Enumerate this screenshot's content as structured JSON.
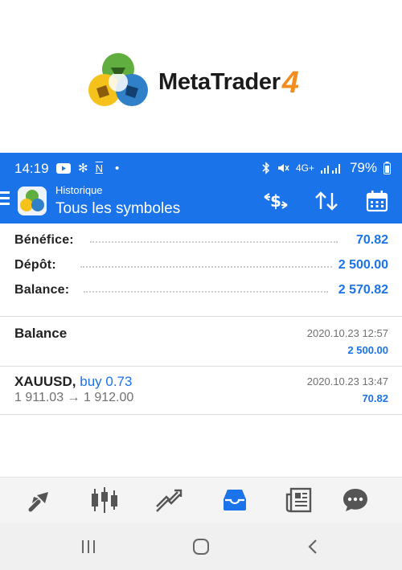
{
  "brand": {
    "name": "MetaTrader",
    "version": "4"
  },
  "status_bar": {
    "time": "14:19",
    "network_label": "4G+",
    "battery": "79%",
    "n_icon_text": "N",
    "dot": "•"
  },
  "toolbar": {
    "subtitle": "Historique",
    "title": "Tous les symboles"
  },
  "summary": [
    {
      "label": "Bénéfice:",
      "value": "70.82"
    },
    {
      "label": "Dépôt:",
      "value": "2 500.00"
    },
    {
      "label": "Balance:",
      "value": "2 570.82"
    }
  ],
  "deals": [
    {
      "title": "Balance",
      "direction": "",
      "subtitle": "",
      "date": "2020.10.23 12:57",
      "amount": "2 500.00"
    },
    {
      "title": "XAUUSD,",
      "direction": " buy 0.73",
      "subtitle": "1 911.03 → 1 912.00",
      "date": "2020.10.23 13:47",
      "amount": "70.82"
    }
  ],
  "bottom_nav": [
    "quotes-icon",
    "chart-icon",
    "trade-icon",
    "history-icon",
    "news-icon",
    "chat-icon"
  ],
  "active_tab": "history-icon",
  "colors": {
    "accent": "#1a73e8",
    "brand_orange": "#f28c1e"
  }
}
